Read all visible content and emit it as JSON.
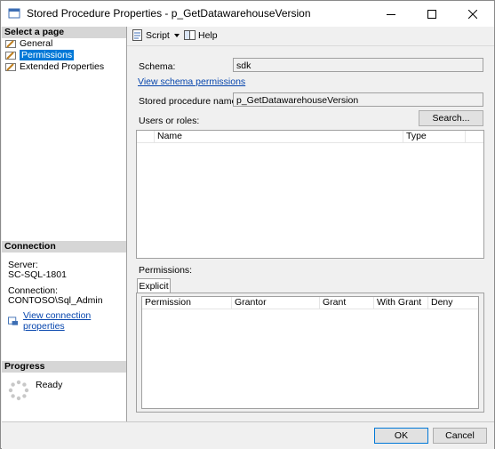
{
  "window": {
    "title": "Stored Procedure Properties - p_GetDatawarehouseVersion"
  },
  "left": {
    "select_page_header": "Select a page",
    "pages": [
      {
        "label": "General",
        "icon": "wrench-page-icon",
        "selected": false
      },
      {
        "label": "Permissions",
        "icon": "wrench-page-icon",
        "selected": true
      },
      {
        "label": "Extended Properties",
        "icon": "wrench-page-icon",
        "selected": false
      }
    ],
    "connection_header": "Connection",
    "server_label": "Server:",
    "server_value": "SC-SQL-1801",
    "connection_label": "Connection:",
    "connection_value": "CONTOSO\\Sql_Admin",
    "view_connection_link": "View connection properties",
    "progress_header": "Progress",
    "progress_status": "Ready"
  },
  "toolbar": {
    "script_label": "Script",
    "help_label": "Help"
  },
  "form": {
    "schema_label": "Schema:",
    "schema_value": "sdk",
    "view_schema_link": "View schema permissions",
    "sp_name_label": "Stored procedure name:",
    "sp_name_value": "p_GetDatawarehouseVersion",
    "users_roles_label": "Users or roles:",
    "search_button": "Search...",
    "users_columns": [
      "Name",
      "Type"
    ],
    "permissions_label": "Permissions:",
    "explicit_tab": "Explicit",
    "perm_columns": [
      "Permission",
      "Grantor",
      "Grant",
      "With Grant",
      "Deny"
    ]
  },
  "buttons": {
    "ok": "OK",
    "cancel": "Cancel"
  },
  "colors": {
    "selection": "#0078d7",
    "link": "#0645ad",
    "header_bg": "#d6d6d6"
  }
}
